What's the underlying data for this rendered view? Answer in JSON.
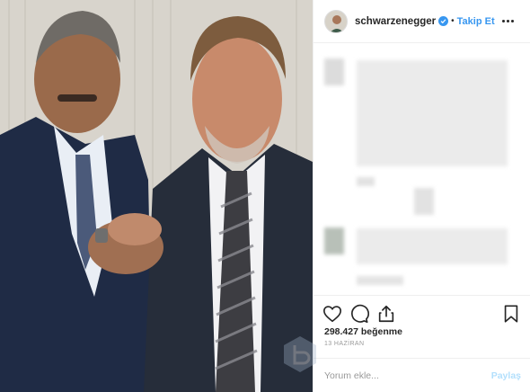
{
  "post": {
    "username": "schwarzenegger",
    "follow_label": "Takip Et",
    "dot": "•",
    "likes_count": "298.427",
    "likes_word": "beğenme",
    "date": "13 HAZİRAN"
  },
  "comment": {
    "placeholder": "Yorum ekle...",
    "post_label": "Paylaş"
  },
  "icons": {
    "more": "more-options-icon",
    "heart": "heart-icon",
    "comment": "comment-icon",
    "share": "share-icon",
    "bookmark": "bookmark-icon",
    "verified": "verified-badge-icon"
  },
  "colors": {
    "accent_blue": "#3897f0",
    "disabled_blue": "#b2dffc",
    "border": "#efefef",
    "text": "#262626",
    "muted": "#999999"
  }
}
